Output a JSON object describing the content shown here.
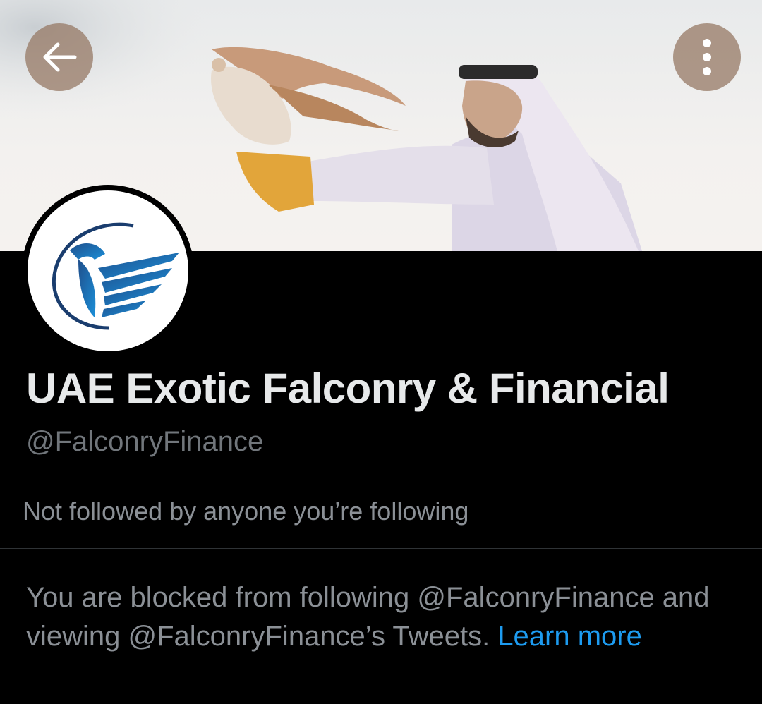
{
  "header": {
    "back_icon": "arrow-left-icon",
    "more_icon": "more-vertical-icon",
    "button_bg": "#96786499"
  },
  "banner": {
    "description_icon": "falconer-photo"
  },
  "profile": {
    "avatar_icon": "falcon-logo",
    "display_name": "UAE Exotic Falconry & Financial",
    "handle": "@FalconryFinance",
    "followed_by": "Not followed by anyone you’re following"
  },
  "blocked": {
    "message": "You are blocked from following @FalconryFinance and viewing @FalconryFinance’s Tweets.",
    "learn_more": "Learn more"
  },
  "colors": {
    "background": "#000000",
    "primary_text": "#e7e9ea",
    "secondary_text": "#71767b",
    "link": "#1d9bf0",
    "divider": "#2f3336",
    "logo_blue": "#1565a8"
  }
}
